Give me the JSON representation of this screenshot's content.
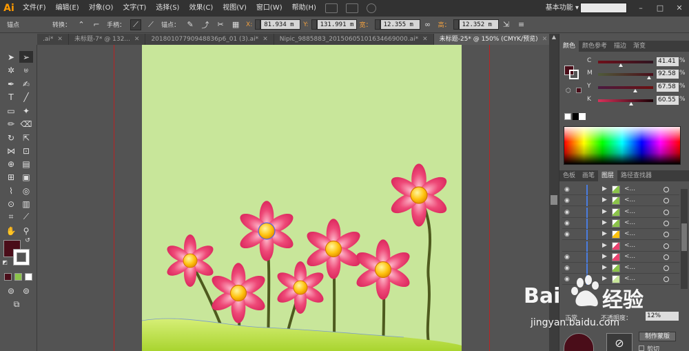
{
  "app": {
    "logo": "Ai",
    "menus": [
      "文件(F)",
      "编辑(E)",
      "对象(O)",
      "文字(T)",
      "选择(S)",
      "效果(C)",
      "视图(V)",
      "窗口(W)",
      "帮助(H)"
    ],
    "workspace": "基本功能",
    "workspace_arrow": "▾"
  },
  "control_bar": {
    "context": "锚点",
    "convert_label": "转换：",
    "handles_label": "手柄：",
    "anchors_label": "锚点：",
    "x_label": "X:",
    "x_value": "81.934 m",
    "y_label": "Y:",
    "y_value": "131.991 m",
    "w_label": "宽：",
    "w_value": "12.355 m",
    "h_label": "高：",
    "h_value": "12.352 m"
  },
  "tabs": [
    {
      "label": ".ai*",
      "active": false
    },
    {
      "label": "未标题-7* @ 132...",
      "active": false
    },
    {
      "label": "20180107790948836p6_01 (3).ai*",
      "active": false
    },
    {
      "label": "Nipic_9885883_20150605101634669000.ai*",
      "active": false
    },
    {
      "label": "未标题-25* @ 150% (CMYK/预览)",
      "active": true
    }
  ],
  "color_panel": {
    "tabs": [
      "颜色",
      "颜色参考",
      "描边",
      "渐变"
    ],
    "sliders": [
      {
        "label": "C",
        "value": "41.41",
        "pct": "%",
        "level": 0.4141
      },
      {
        "label": "M",
        "value": "92.58",
        "pct": "%",
        "level": 0.9258
      },
      {
        "label": "Y",
        "value": "67.58",
        "pct": "%",
        "level": 0.6758
      },
      {
        "label": "K",
        "value": "60.55",
        "pct": "%",
        "level": 0.6055
      }
    ],
    "fill_color": "#4a0d19"
  },
  "layers_panel": {
    "tabs": [
      "色板",
      "画笔",
      "图层",
      "路径查找器"
    ],
    "row_name": "<...",
    "row_count": 9
  },
  "bottom_panel": {
    "blend_mode": "正常",
    "opacity_label": "不透明度：",
    "opacity_value": "12%",
    "make_mask": "制作蒙版",
    "clip": "剪切"
  },
  "watermark": {
    "brand": "Bai",
    "brand2": "经验",
    "url": "jingyan.baidu.com"
  },
  "colors": {
    "artboard": "#c8e69a",
    "petal": "#e8436f",
    "center": "#ffc20e",
    "stem": "#4e5a1e"
  }
}
